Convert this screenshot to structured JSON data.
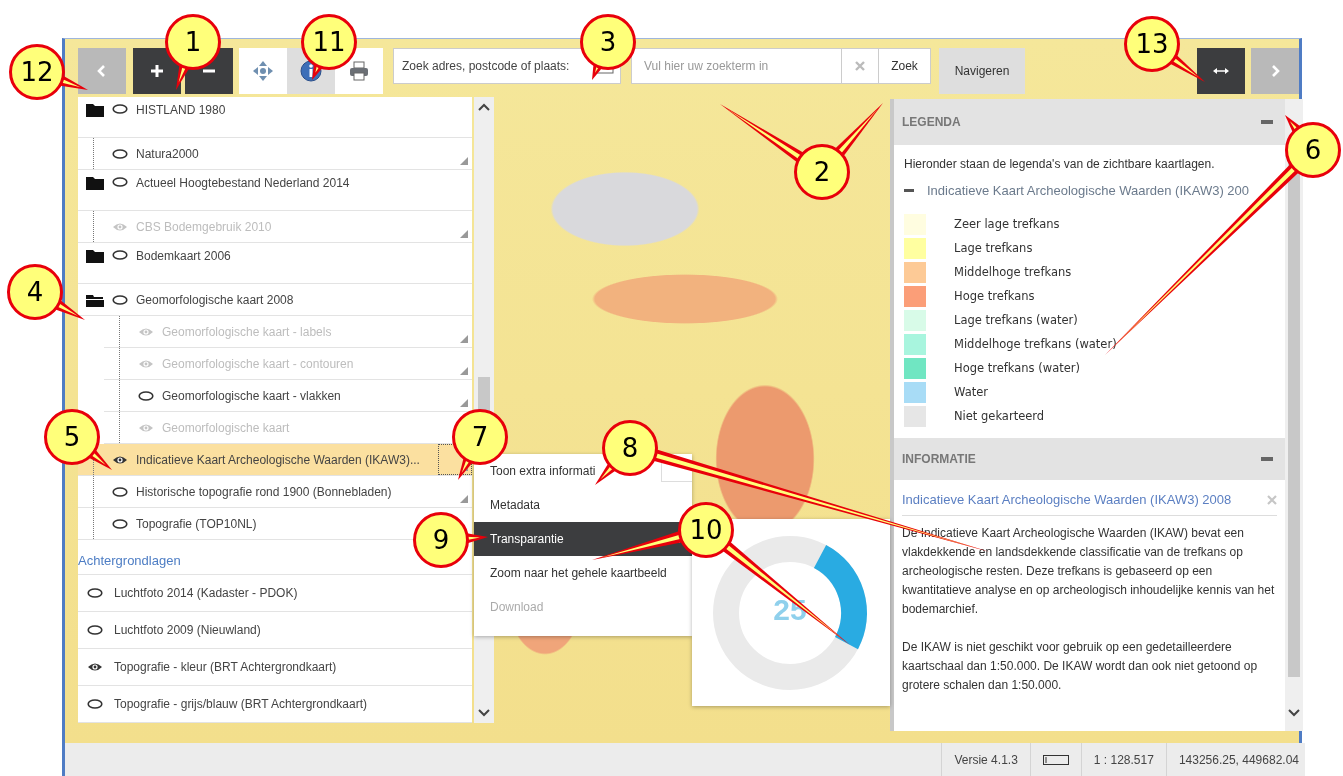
{
  "toolbar": {
    "tools": [
      {
        "kind": "pan",
        "selected": false
      },
      {
        "kind": "info",
        "selected": true
      },
      {
        "kind": "print",
        "selected": false
      }
    ],
    "search_label": "Zoek adres, postcode of plaats:",
    "search": {
      "placeholder": "Vul hier uw zoekterm in"
    },
    "search_button": "Zoek",
    "navigate_button": "Navigeren"
  },
  "layers": [
    {
      "kind": "folder",
      "label": "HISTLAND 1980",
      "expanded": false,
      "visible": false,
      "disabled": false,
      "has_menu": false,
      "selected": false
    },
    {
      "kind": "layer",
      "label": "Natura2000",
      "visible": false,
      "disabled": false,
      "has_menu": true,
      "selected": false
    },
    {
      "kind": "folder",
      "label": "Actueel Hoogtebestand Nederland 2014",
      "expanded": false,
      "visible": false,
      "disabled": false,
      "has_menu": false,
      "selected": false
    },
    {
      "kind": "layer",
      "label": "CBS Bodemgebruik 2010",
      "visible": true,
      "disabled": true,
      "has_menu": true,
      "selected": false
    },
    {
      "kind": "folder",
      "label": "Bodemkaart 2006",
      "expanded": false,
      "visible": false,
      "disabled": false,
      "has_menu": false,
      "selected": false
    },
    {
      "kind": "folder",
      "label": "Geomorfologische kaart 2008",
      "expanded": true,
      "visible": false,
      "disabled": false,
      "has_menu": false,
      "selected": false,
      "children": [
        {
          "kind": "layer",
          "label": "Geomorfologische kaart - labels",
          "visible": true,
          "disabled": true,
          "has_menu": true,
          "selected": false
        },
        {
          "kind": "layer",
          "label": "Geomorfologische kaart - contouren",
          "visible": true,
          "disabled": true,
          "has_menu": true,
          "selected": false
        },
        {
          "kind": "layer",
          "label": "Geomorfologische kaart - vlakken",
          "visible": false,
          "disabled": false,
          "has_menu": true,
          "selected": false
        },
        {
          "kind": "layer",
          "label": "Geomorfologische kaart",
          "visible": true,
          "disabled": true,
          "has_menu": false,
          "selected": false
        }
      ]
    },
    {
      "kind": "layer",
      "label": "Indicatieve Kaart Archeologische Waarden (IKAW3)...",
      "visible": true,
      "disabled": false,
      "has_menu": true,
      "selected": true
    },
    {
      "kind": "layer",
      "label": "Historische topografie rond 1900 (Bonnebladen)",
      "visible": false,
      "disabled": false,
      "has_menu": true,
      "selected": false
    },
    {
      "kind": "layer",
      "label": "Topografie (TOP10NL)",
      "visible": false,
      "disabled": false,
      "has_menu": false,
      "selected": false
    }
  ],
  "background_heading": "Achtergrondlagen",
  "background_layers": [
    {
      "label": "Luchtfoto 2014 (Kadaster - PDOK)",
      "visible": false
    },
    {
      "label": "Luchtfoto 2009 (Nieuwland)",
      "visible": false
    },
    {
      "label": "Topografie - kleur (BRT Achtergrondkaart)",
      "visible": true
    },
    {
      "label": "Topografie - grijs/blauw (BRT Achtergrondkaart)",
      "visible": false
    }
  ],
  "context_menu": [
    {
      "label": "Toon extra informati",
      "selected": false,
      "disabled": false
    },
    {
      "label": "Metadata",
      "selected": false,
      "disabled": false
    },
    {
      "label": "Transparantie",
      "selected": true,
      "disabled": false
    },
    {
      "label": "Zoom naar het gehele kaartbeeld",
      "selected": false,
      "disabled": false
    },
    {
      "label": "Download",
      "selected": false,
      "disabled": true
    }
  ],
  "transparency": {
    "level": 0.25,
    "value": "25"
  },
  "legend": {
    "title": "LEGENDA",
    "intro": "Hieronder staan de legenda's van de zichtbare kaartlagen.",
    "group": "Indicatieve Kaart Archeologische Waarden (IKAW3) 200",
    "items": [
      {
        "label": "Zeer lage trefkans",
        "color": "#fffde0"
      },
      {
        "label": "Lage trefkans",
        "color": "#ffffa0"
      },
      {
        "label": "Middelhoge trefkans",
        "color": "#fdca96"
      },
      {
        "label": "Hoge trefkans",
        "color": "#fb9e78"
      },
      {
        "label": "Lage trefkans (water)",
        "color": "#d8fbe8"
      },
      {
        "label": "Middelhoge trefkans (water)",
        "color": "#a8f5de"
      },
      {
        "label": "Hoge trefkans (water)",
        "color": "#70e6c2"
      },
      {
        "label": "Water",
        "color": "#a8dcf6"
      },
      {
        "label": "Niet gekarteerd",
        "color": "#e6e6e6"
      }
    ]
  },
  "info": {
    "title": "INFORMATIE",
    "layer_title": "Indicatieve Kaart Archeologische Waarden (IKAW3) 2008",
    "paragraphs": [
      "De Indicatieve Kaart Archeologische Waarden (IKAW) bevat een vlakdekkende en landsdekkende classificatie van de trefkans op archeologische resten. Deze trefkans is gebaseerd op een kwantitatieve analyse en op archeologisch inhoudelijke kennis van het bodemarchief.",
      "De IKAW is niet geschikt voor gebruik op een gedetailleerdere kaartschaal dan 1:50.000. De IKAW wordt dan ook niet getoond op grotere schalen dan 1:50.000."
    ]
  },
  "status_bar": {
    "version": "Versie 4.1.3",
    "scale": "1 : 128.517",
    "coordinates": "143256.25, 449682.04"
  },
  "callouts": [
    {
      "label": "1"
    },
    {
      "label": "11"
    },
    {
      "label": "3"
    },
    {
      "label": "12"
    },
    {
      "label": "13"
    },
    {
      "label": "2"
    },
    {
      "label": "6"
    },
    {
      "label": "4"
    },
    {
      "label": "5"
    },
    {
      "label": "7"
    },
    {
      "label": "8"
    },
    {
      "label": "9"
    },
    {
      "label": "10"
    }
  ]
}
